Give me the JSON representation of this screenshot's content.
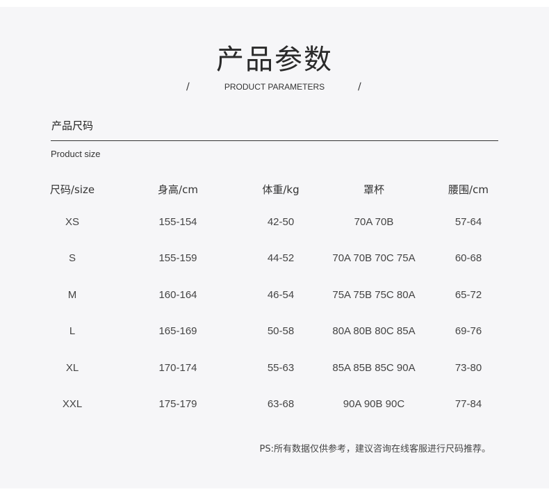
{
  "header": {
    "title": "产品参数",
    "slash": "/",
    "subtitle": "PRODUCT PARAMETERS"
  },
  "section": {
    "title": "产品尺码",
    "subtitle": "Product size"
  },
  "table": {
    "headers": [
      "尺码/size",
      "身高/cm",
      "体重/kg",
      "罩杯",
      "腰围/cm"
    ],
    "rows": [
      [
        "XS",
        "155-154",
        "42-50",
        "70A  70B",
        "57-64"
      ],
      [
        "S",
        "155-159",
        "44-52",
        "70A  70B  70C  75A",
        "60-68"
      ],
      [
        "M",
        "160-164",
        "46-54",
        "75A  75B  75C  80A",
        "65-72"
      ],
      [
        "L",
        "165-169",
        "50-58",
        "80A  80B  80C  85A",
        "69-76"
      ],
      [
        "XL",
        "170-174",
        "55-63",
        "85A  85B  85C  90A",
        "73-80"
      ],
      [
        "XXL",
        "175-179",
        "63-68",
        "90A  90B  90C",
        "77-84"
      ]
    ]
  },
  "note": "PS:所有数据仅供参考，建议咨询在线客服进行尺码推荐。"
}
